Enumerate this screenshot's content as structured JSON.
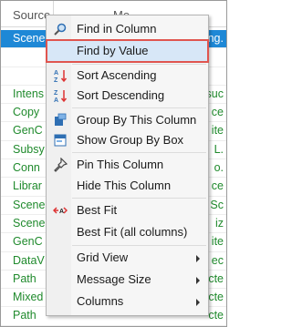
{
  "grid": {
    "headers": [
      "Source",
      "Me"
    ],
    "rows": [
      {
        "c1": "Scene",
        "c2": "ng.",
        "selected": true
      },
      {
        "c1": "",
        "c2": "",
        "selected": false
      },
      {
        "c1": "",
        "c2": "",
        "selected": false
      },
      {
        "c1": "Intens",
        "c2": "suc",
        "selected": false
      },
      {
        "c1": "Copy",
        "c2": "ce",
        "selected": false
      },
      {
        "c1": "GenC",
        "c2": "ite",
        "selected": false
      },
      {
        "c1": "Subsy",
        "c2": "L.",
        "selected": false
      },
      {
        "c1": "Conn",
        "c2": "o.",
        "selected": false
      },
      {
        "c1": "Librar",
        "c2": "ce",
        "selected": false
      },
      {
        "c1": "Scene",
        "c2": "Sc",
        "selected": false
      },
      {
        "c1": "Scene",
        "c2": "iz",
        "selected": false
      },
      {
        "c1": "GenC",
        "c2": "ite",
        "selected": false
      },
      {
        "c1": "DataV",
        "c2": "ec",
        "selected": false
      },
      {
        "c1": "Path",
        "c2": "cte",
        "selected": false
      },
      {
        "c1": "Mixed",
        "c2": "cte",
        "selected": false
      },
      {
        "c1": "Path",
        "c2": "cte",
        "selected": false
      }
    ]
  },
  "menu": {
    "find_in_column": "Find in Column",
    "find_by_value": "Find by Value",
    "sort_ascending": "Sort Ascending",
    "sort_descending": "Sort Descending",
    "group_by_column": "Group By This Column",
    "show_group_box": "Show Group By Box",
    "pin_column": "Pin This Column",
    "hide_column": "Hide This Column",
    "best_fit": "Best Fit",
    "best_fit_all": "Best Fit (all columns)",
    "grid_view": "Grid View",
    "message_size": "Message Size",
    "columns": "Columns"
  },
  "colors": {
    "selection": "#1e88d6",
    "highlight_outline": "#e0554f",
    "highlight_fill": "#d7e7f7",
    "grid_text": "#1f8a2c"
  }
}
